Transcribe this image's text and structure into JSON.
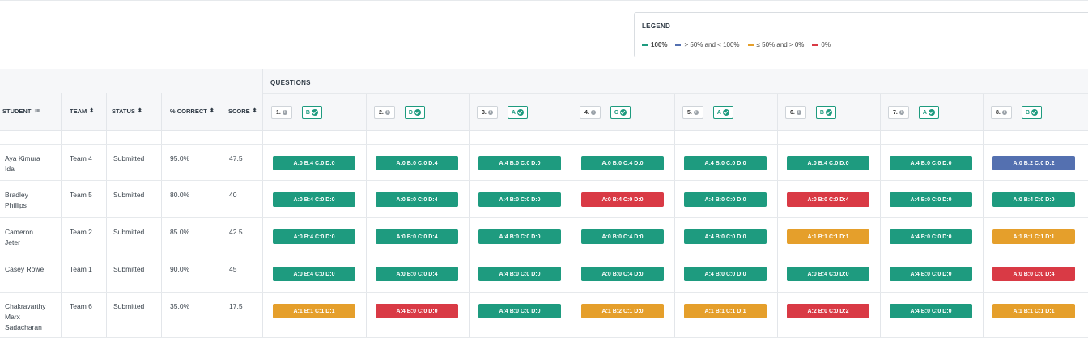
{
  "legend": {
    "title": "LEGEND",
    "items": [
      {
        "label": "100%",
        "color": "#1e9b7f",
        "bold": true
      },
      {
        "label": "> 50% and < 100%",
        "color": "#5470b0",
        "bold": false
      },
      {
        "label": "≤ 50% and > 0%",
        "color": "#e59f2b",
        "bold": false
      },
      {
        "label": "0%",
        "color": "#d93a45",
        "bold": false
      }
    ]
  },
  "table": {
    "questions_label": "QUESTIONS",
    "columns": [
      {
        "key": "student",
        "label": "STUDENT",
        "sort_icon": "sort-desc-icon"
      },
      {
        "key": "team",
        "label": "TEAM",
        "sort_icon": "sort-icon"
      },
      {
        "key": "status",
        "label": "STATUS",
        "sort_icon": "sort-icon"
      },
      {
        "key": "pct",
        "label": "% CORRECT",
        "sort_icon": "sort-icon"
      },
      {
        "key": "score",
        "label": "SCORE",
        "sort_icon": "sort-icon"
      }
    ],
    "questions": [
      {
        "num": "1.",
        "answer": "B"
      },
      {
        "num": "2.",
        "answer": "D"
      },
      {
        "num": "3.",
        "answer": "A"
      },
      {
        "num": "4.",
        "answer": "C"
      },
      {
        "num": "5.",
        "answer": "A"
      },
      {
        "num": "6.",
        "answer": "B"
      },
      {
        "num": "7.",
        "answer": "A"
      },
      {
        "num": "8.",
        "answer": "B"
      }
    ],
    "colors": {
      "green": "#1e9b7f",
      "blue": "#5470b0",
      "orange": "#e59f2b",
      "red": "#d93a45"
    },
    "rows": [
      {
        "student": [
          "Aya Kimura",
          "Ida"
        ],
        "team": "Team 4",
        "status": "Submitted",
        "pct": "95.0%",
        "score": "47.5",
        "answers": [
          {
            "text": "A:0 B:4 C:0 D:0",
            "level": "green"
          },
          {
            "text": "A:0 B:0 C:0 D:4",
            "level": "green"
          },
          {
            "text": "A:4 B:0 C:0 D:0",
            "level": "green"
          },
          {
            "text": "A:0 B:0 C:4 D:0",
            "level": "green"
          },
          {
            "text": "A:4 B:0 C:0 D:0",
            "level": "green"
          },
          {
            "text": "A:0 B:4 C:0 D:0",
            "level": "green"
          },
          {
            "text": "A:4 B:0 C:0 D:0",
            "level": "green"
          },
          {
            "text": "A:0 B:2 C:0 D:2",
            "level": "blue"
          }
        ]
      },
      {
        "student": [
          "Bradley",
          "Phillips"
        ],
        "team": "Team 5",
        "status": "Submitted",
        "pct": "80.0%",
        "score": "40",
        "answers": [
          {
            "text": "A:0 B:4 C:0 D:0",
            "level": "green"
          },
          {
            "text": "A:0 B:0 C:0 D:4",
            "level": "green"
          },
          {
            "text": "A:4 B:0 C:0 D:0",
            "level": "green"
          },
          {
            "text": "A:0 B:4 C:0 D:0",
            "level": "red"
          },
          {
            "text": "A:4 B:0 C:0 D:0",
            "level": "green"
          },
          {
            "text": "A:0 B:0 C:0 D:4",
            "level": "red"
          },
          {
            "text": "A:4 B:0 C:0 D:0",
            "level": "green"
          },
          {
            "text": "A:0 B:4 C:0 D:0",
            "level": "green"
          }
        ]
      },
      {
        "student": [
          "Cameron",
          "Jeter"
        ],
        "team": "Team 2",
        "status": "Submitted",
        "pct": "85.0%",
        "score": "42.5",
        "answers": [
          {
            "text": "A:0 B:4 C:0 D:0",
            "level": "green"
          },
          {
            "text": "A:0 B:0 C:0 D:4",
            "level": "green"
          },
          {
            "text": "A:4 B:0 C:0 D:0",
            "level": "green"
          },
          {
            "text": "A:0 B:0 C:4 D:0",
            "level": "green"
          },
          {
            "text": "A:4 B:0 C:0 D:0",
            "level": "green"
          },
          {
            "text": "A:1 B:1 C:1 D:1",
            "level": "orange"
          },
          {
            "text": "A:4 B:0 C:0 D:0",
            "level": "green"
          },
          {
            "text": "A:1 B:1 C:1 D:1",
            "level": "orange"
          }
        ]
      },
      {
        "student": [
          "Casey Rowe"
        ],
        "team": "Team 1",
        "status": "Submitted",
        "pct": "90.0%",
        "score": "45",
        "answers": [
          {
            "text": "A:0 B:4 C:0 D:0",
            "level": "green"
          },
          {
            "text": "A:0 B:0 C:0 D:4",
            "level": "green"
          },
          {
            "text": "A:4 B:0 C:0 D:0",
            "level": "green"
          },
          {
            "text": "A:0 B:0 C:4 D:0",
            "level": "green"
          },
          {
            "text": "A:4 B:0 C:0 D:0",
            "level": "green"
          },
          {
            "text": "A:0 B:4 C:0 D:0",
            "level": "green"
          },
          {
            "text": "A:4 B:0 C:0 D:0",
            "level": "green"
          },
          {
            "text": "A:0 B:0 C:0 D:4",
            "level": "red"
          }
        ]
      },
      {
        "student": [
          "Chakravarthy",
          "Marx",
          "Sadacharan"
        ],
        "team": "Team 6",
        "status": "Submitted",
        "pct": "35.0%",
        "score": "17.5",
        "answers": [
          {
            "text": "A:1 B:1 C:1 D:1",
            "level": "orange"
          },
          {
            "text": "A:4 B:0 C:0 D:0",
            "level": "red"
          },
          {
            "text": "A:4 B:0 C:0 D:0",
            "level": "green"
          },
          {
            "text": "A:1 B:2 C:1 D:0",
            "level": "orange"
          },
          {
            "text": "A:1 B:1 C:1 D:1",
            "level": "orange"
          },
          {
            "text": "A:2 B:0 C:0 D:2",
            "level": "red"
          },
          {
            "text": "A:4 B:0 C:0 D:0",
            "level": "green"
          },
          {
            "text": "A:1 B:1 C:1 D:1",
            "level": "orange"
          }
        ]
      }
    ]
  }
}
